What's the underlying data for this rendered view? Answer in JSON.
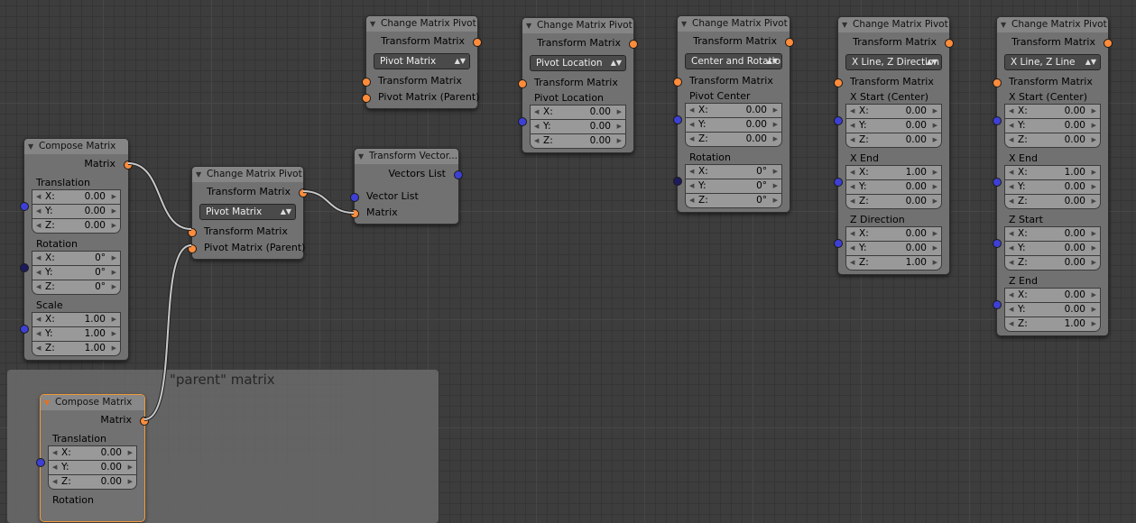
{
  "frame": {
    "label": "\"parent\" matrix"
  },
  "nodes": {
    "compose1": {
      "title": "Compose Matrix",
      "output": "Matrix",
      "translation": {
        "label": "Translation",
        "x": "0.00",
        "y": "0.00",
        "z": "0.00"
      },
      "rotation": {
        "label": "Rotation",
        "x": "0°",
        "y": "0°",
        "z": "0°"
      },
      "scale": {
        "label": "Scale",
        "x": "1.00",
        "y": "1.00",
        "z": "1.00"
      }
    },
    "compose2": {
      "title": "Compose Matrix",
      "output": "Matrix",
      "translation": {
        "label": "Translation",
        "x": "0.00",
        "y": "0.00",
        "z": "0.00"
      },
      "rotation": {
        "label": "Rotation"
      }
    },
    "pivot_main": {
      "title": "Change Matrix Pivot",
      "output": "Transform Matrix",
      "mode": "Pivot Matrix",
      "in1": "Transform Matrix",
      "in2": "Pivot Matrix (Parent)"
    },
    "transform_vec": {
      "title": "Transform Vector...",
      "output": "Vectors List",
      "in1": "Vector List",
      "in2": "Matrix"
    },
    "pivot_a": {
      "title": "Change Matrix Pivot",
      "output": "Transform Matrix",
      "mode": "Pivot Matrix",
      "in1": "Transform Matrix",
      "in2": "Pivot Matrix (Parent)"
    },
    "pivot_b": {
      "title": "Change Matrix Pivot",
      "output": "Transform Matrix",
      "mode": "Pivot Location",
      "in1": "Transform Matrix",
      "location": {
        "label": "Pivot Location",
        "x": "0.00",
        "y": "0.00",
        "z": "0.00"
      }
    },
    "pivot_c": {
      "title": "Change Matrix Pivot",
      "output": "Transform Matrix",
      "mode": "Center and Rotation",
      "in1": "Transform Matrix",
      "center": {
        "label": "Pivot Center",
        "x": "0.00",
        "y": "0.00",
        "z": "0.00"
      },
      "rotation": {
        "label": "Rotation",
        "x": "0°",
        "y": "0°",
        "z": "0°"
      }
    },
    "pivot_d": {
      "title": "Change Matrix Pivot",
      "output": "Transform Matrix",
      "mode": "X Line, Z Direction",
      "in1": "Transform Matrix",
      "xstart": {
        "label": "X Start (Center)",
        "x": "0.00",
        "y": "0.00",
        "z": "0.00"
      },
      "xend": {
        "label": "X End",
        "x": "1.00",
        "y": "0.00",
        "z": "0.00"
      },
      "zdir": {
        "label": "Z Direction (Normal)",
        "x": "0.00",
        "y": "0.00",
        "z": "1.00"
      }
    },
    "pivot_e": {
      "title": "Change Matrix Pivot",
      "output": "Transform Matrix",
      "mode": "X Line, Z Line",
      "in1": "Transform Matrix",
      "xstart": {
        "label": "X Start (Center)",
        "x": "0.00",
        "y": "0.00",
        "z": "0.00"
      },
      "xend": {
        "label": "X End",
        "x": "1.00",
        "y": "0.00",
        "z": "0.00"
      },
      "zstart": {
        "label": "Z Start",
        "x": "0.00",
        "y": "0.00",
        "z": "0.00"
      },
      "zend": {
        "label": "Z End",
        "x": "0.00",
        "y": "0.00",
        "z": "1.00"
      }
    }
  },
  "axis": {
    "x": "X:",
    "y": "Y:",
    "z": "Z:"
  },
  "colors": {
    "matrix_socket": "#ff8c3a",
    "vector_socket": "#3e3fd6",
    "rotation_socket": "#1d1a5e",
    "wire": "#c8c8c8",
    "selected_border": "#f09a3a"
  }
}
